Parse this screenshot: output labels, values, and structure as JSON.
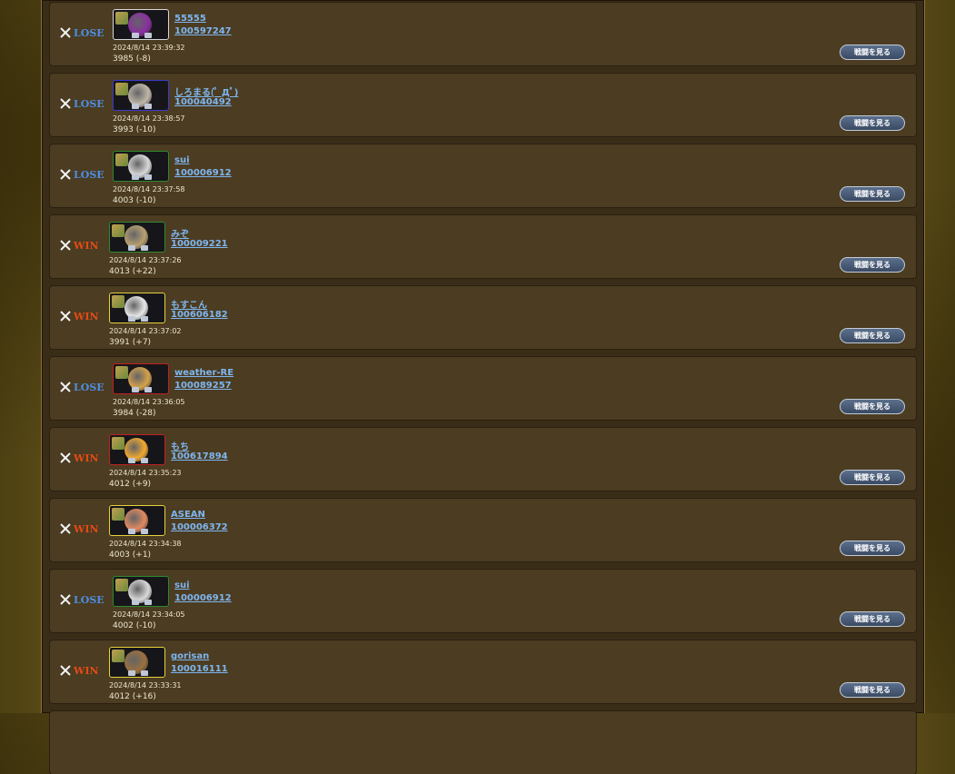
{
  "button_label": "戦闘を見る",
  "colors": {
    "lose": "#4d8fe3",
    "win": "#e44a14",
    "link": "#7fb6f0"
  },
  "matches": [
    {
      "result": "LOSE",
      "name": "55555",
      "id": "100597247",
      "time": "2024/8/14 23:39:32",
      "score": "3985 (-8)",
      "frame": "#d8d8d8",
      "avatar": "#8a2fa0"
    },
    {
      "result": "LOSE",
      "name": "しろまる(ﾟ Дﾟ)",
      "id": "100040492",
      "time": "2024/8/14 23:38:57",
      "score": "3993 (-10)",
      "frame": "#3a3acf",
      "avatar": "#bfb6a8"
    },
    {
      "result": "LOSE",
      "name": "sui",
      "id": "100006912",
      "time": "2024/8/14 23:37:58",
      "score": "4003 (-10)",
      "frame": "#2f8a2f",
      "avatar": "#d8d8d8"
    },
    {
      "result": "WIN",
      "name": "みぞ",
      "id": "100009221",
      "time": "2024/8/14 23:37:26",
      "score": "4013 (+22)",
      "frame": "#2f8a2f",
      "avatar": "#b8a070"
    },
    {
      "result": "WIN",
      "name": "もすこん",
      "id": "100606182",
      "time": "2024/8/14 23:37:02",
      "score": "3991 (+7)",
      "frame": "#e6d23a",
      "avatar": "#e8e8e8"
    },
    {
      "result": "LOSE",
      "name": "weather-RE",
      "id": "100089257",
      "time": "2024/8/14 23:36:05",
      "score": "3984 (-28)",
      "frame": "#c42020",
      "avatar": "#d4a24a"
    },
    {
      "result": "WIN",
      "name": "もち",
      "id": "100617894",
      "time": "2024/8/14 23:35:23",
      "score": "4012 (+9)",
      "frame": "#c42020",
      "avatar": "#f0a830"
    },
    {
      "result": "WIN",
      "name": "ASEAN",
      "id": "100006372",
      "time": "2024/8/14 23:34:38",
      "score": "4003 (+1)",
      "frame": "#e6d23a",
      "avatar": "#e08a60"
    },
    {
      "result": "LOSE",
      "name": "sui",
      "id": "100006912",
      "time": "2024/8/14 23:34:05",
      "score": "4002 (-10)",
      "frame": "#2f8a2f",
      "avatar": "#d8d8d8"
    },
    {
      "result": "WIN",
      "name": "gorisan",
      "id": "100016111",
      "time": "2024/8/14 23:33:31",
      "score": "4012 (+16)",
      "frame": "#e6d23a",
      "avatar": "#9a7040"
    }
  ]
}
